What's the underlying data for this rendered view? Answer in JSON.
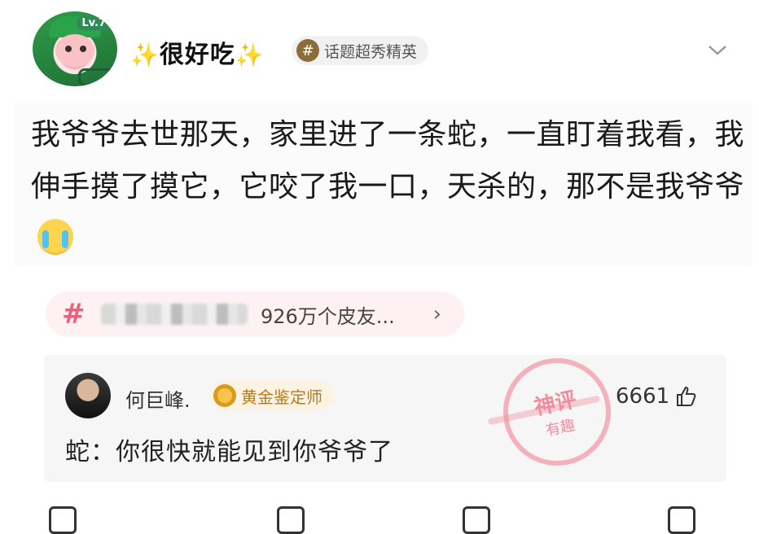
{
  "header": {
    "username": "很好吃",
    "badge_icon": "hashtag-icon",
    "badge_label": "话题超秀精英",
    "avatar_level": "Lv.7"
  },
  "post": {
    "text": "我爷爷去世那天，家里进了一条蛇，一直盯着我看，我伸手摸了摸它，它咬了我一口，天杀的，那不是我爷爷",
    "emoji": "crying-face"
  },
  "topic": {
    "hash": "#",
    "count_text": "926万个皮友...",
    "arrow": "›"
  },
  "comment": {
    "author": "何巨峰.",
    "rank_label": "黄金鉴定师",
    "likes": "6661",
    "text": "蛇：你很快就能见到你爷爷了",
    "stamp_line1": "神评",
    "stamp_line2": "有趣"
  },
  "colors": {
    "accent_pink": "#f25d7a",
    "gold": "#b8791d"
  }
}
